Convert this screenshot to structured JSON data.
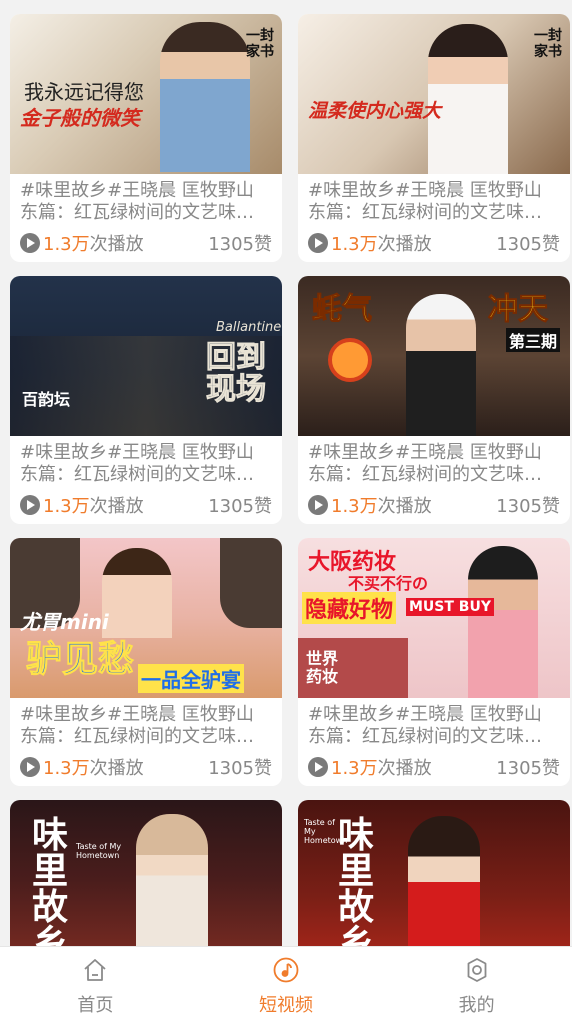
{
  "colors": {
    "accent": "#f07c2c",
    "text_muted": "#888888",
    "background": "#f2f2f2"
  },
  "cards": [
    {
      "thumb": {
        "overlay_1": "我永远记得您",
        "overlay_2": "金子般的微笑",
        "badge": "一封家书"
      },
      "title_line1": "#味里故乡#王晓晨 匡牧野山",
      "title_line2": "东篇：红瓦绿树间的文艺味…",
      "plays_count": "1.3万",
      "plays_suffix": "次播放",
      "likes": "1305赞"
    },
    {
      "thumb": {
        "overlay_1": "温柔使内心强大",
        "badge": "一封家书"
      },
      "title_line1": "#味里故乡#王晓晨 匡牧野山",
      "title_line2": "东篇：红瓦绿树间的文艺味…",
      "plays_count": "1.3万",
      "plays_suffix": "次播放",
      "likes": "1305赞"
    },
    {
      "thumb": {
        "overlay_1": "回到现场",
        "overlay_2": "百韵坛",
        "overlay_3": "Ballantine's"
      },
      "title_line1": "#味里故乡#王晓晨 匡牧野山",
      "title_line2": "东篇：红瓦绿树间的文艺味…",
      "plays_count": "1.3万",
      "plays_suffix": "次播放",
      "likes": "1305赞"
    },
    {
      "thumb": {
        "overlay_1": "蚝气",
        "overlay_2": "冲天",
        "overlay_3": "第三期"
      },
      "title_line1": "#味里故乡#王晓晨 匡牧野山",
      "title_line2": "东篇：红瓦绿树间的文艺味…",
      "plays_count": "1.3万",
      "plays_suffix": "次播放",
      "likes": "1305赞"
    },
    {
      "thumb": {
        "overlay_1": "尤胃mini",
        "overlay_2": "驴见愁",
        "overlay_3": "一品全驴宴"
      },
      "title_line1": "#味里故乡#王晓晨 匡牧野山",
      "title_line2": "东篇：红瓦绿树间的文艺味…",
      "plays_count": "1.3万",
      "plays_suffix": "次播放",
      "likes": "1305赞"
    },
    {
      "thumb": {
        "overlay_1": "大阪药妆",
        "overlay_2": "不买不行の",
        "overlay_3": "隐藏好物",
        "overlay_4": "MUST BUY",
        "overlay_5": "世界药妆"
      },
      "title_line1": "#味里故乡#王晓晨 匡牧野山",
      "title_line2": "东篇：红瓦绿树间的文艺味…",
      "plays_count": "1.3万",
      "plays_suffix": "次播放",
      "likes": "1305赞"
    },
    {
      "thumb": {
        "overlay_1": "味里故乡",
        "overlay_2": "Taste of My Hometown"
      }
    },
    {
      "thumb": {
        "overlay_1": "味里故乡",
        "overlay_2": "Taste of My Hometown"
      }
    }
  ],
  "tabbar": {
    "tabs": [
      {
        "label": "首页",
        "icon": "home-icon",
        "active": false
      },
      {
        "label": "短视频",
        "icon": "music-note-icon",
        "active": true
      },
      {
        "label": "我的",
        "icon": "gear-icon",
        "active": false
      }
    ]
  }
}
